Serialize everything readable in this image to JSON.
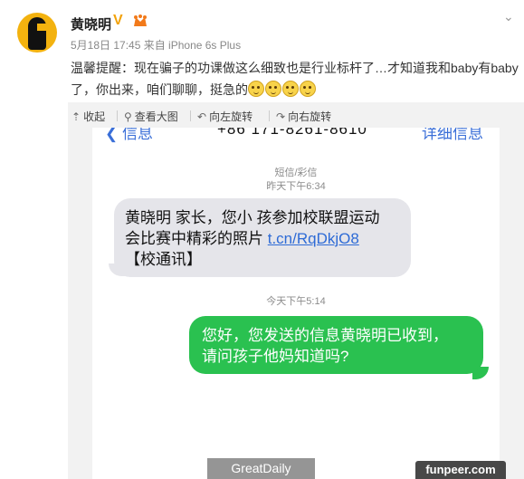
{
  "post": {
    "author": "黄晓明",
    "verified_badge": "V",
    "meta": "5月18日 17:45 来自 iPhone 6s Plus",
    "text": "温馨提醒：现在骗子的功课做这么细致也是行业标杆了…才知道我和baby有baby了，你出来，咱们聊聊，挺急的",
    "emoji_count": 4
  },
  "image_toolbar": {
    "collapse": "收起",
    "view_large": "查看大图",
    "rotate_left": "向左旋转",
    "rotate_right": "向右旋转"
  },
  "sms": {
    "back": "信息",
    "phone_number": "+86 171-8261-8610",
    "details": "详细信息",
    "type_label": "短信/彩信",
    "time1": "昨天下午6:34",
    "incoming_line1": "黄晓明 家长，您小 孩参加校联盟运动",
    "incoming_line2a": "会比赛中精彩的照片 ",
    "incoming_link": "t.cn/RqDkjO8",
    "incoming_line3": "【校通讯】",
    "time2": "今天下午5:14",
    "outgoing_line1": "您好，您发送的信息黄晓明已收到，",
    "outgoing_line2": "请问孩子他妈知道吗?"
  },
  "watermarks": {
    "left": "GreatDaily",
    "right": "funpeer.com"
  },
  "colors": {
    "outgoing_bubble": "#2ac150",
    "incoming_bubble": "#e5e5ea",
    "link": "#2e6bd6",
    "verified": "#f2a20a"
  }
}
